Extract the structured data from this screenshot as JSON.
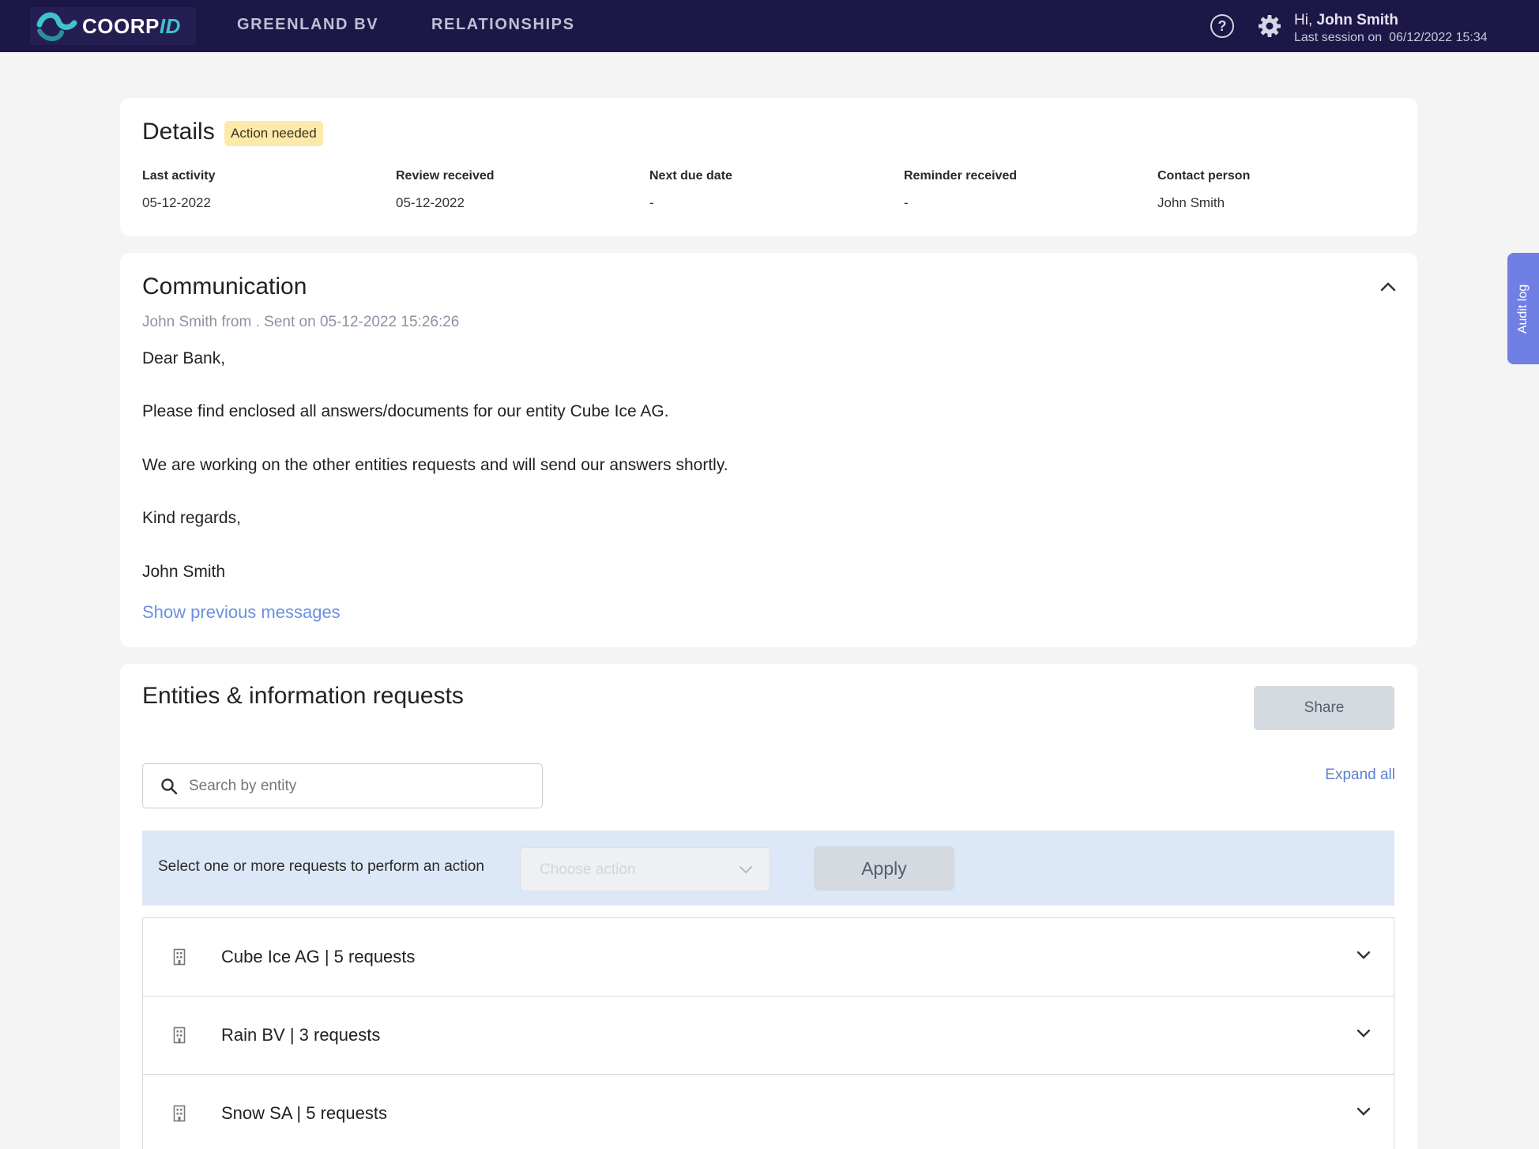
{
  "app": {
    "logo_main": "COORP",
    "logo_accent": "ID",
    "nav": [
      "GREENLAND BV",
      "RELATIONSHIPS"
    ],
    "user": {
      "greeting_prefix": "Hi, ",
      "name": "John Smith",
      "session_label": "Last session on",
      "session_time": "06/12/2022 15:34"
    },
    "icons": {
      "help": "help-icon",
      "settings": "gear-icon"
    }
  },
  "details": {
    "title": "Details",
    "badge": "Action needed",
    "fields": [
      {
        "label": "Last activity",
        "value": "05-12-2022"
      },
      {
        "label": "Review received",
        "value": "05-12-2022"
      },
      {
        "label": "Next due date",
        "value": "-"
      },
      {
        "label": "Reminder received",
        "value": "-"
      },
      {
        "label": "Contact person",
        "value": "John Smith"
      }
    ]
  },
  "communication": {
    "title": "Communication",
    "meta": "John Smith from . Sent on 05-12-2022 15:26:26",
    "lines": [
      "Dear Bank,",
      "Please find enclosed all answers/documents for our entity Cube Ice AG.",
      "We are working on the other entities requests and will send our answers shortly.",
      "Kind regards,",
      "John Smith"
    ],
    "show_previous": "Show previous messages"
  },
  "entities": {
    "title": "Entities & information requests",
    "share_label": "Share",
    "search_placeholder": "Search by entity",
    "expand_all": "Expand all",
    "action_prompt": "Select one or more requests to perform an action",
    "choose_placeholder": "Choose action",
    "apply_label": "Apply",
    "rows": [
      {
        "label": "Cube Ice AG | 5 requests"
      },
      {
        "label": "Rain BV | 3 requests"
      },
      {
        "label": "Snow SA | 5 requests"
      }
    ]
  },
  "audit_tab": "Audit log",
  "colors": {
    "nav_bg": "#1d1747",
    "badge_bg": "#fde9a9",
    "link": "#6b8fe0",
    "action_bar": "#dce7f7",
    "audit_tab": "#6f7fe3"
  }
}
